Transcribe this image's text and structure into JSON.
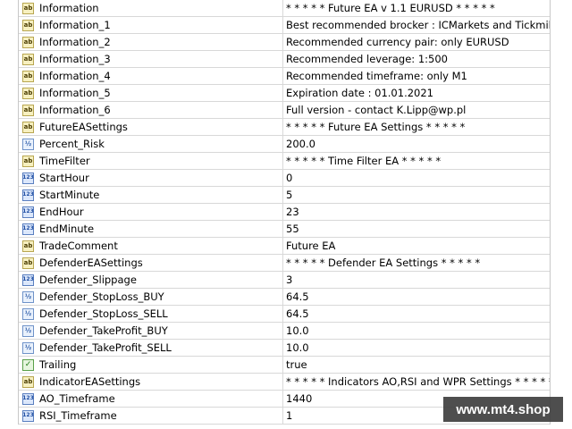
{
  "params": [
    {
      "name": "Information",
      "value": "* * * * * Future EA v 1.1 EURUSD * * * * *",
      "type": "str"
    },
    {
      "name": "Information_1",
      "value": "Best recommended brocker : ICMarkets and Tickmil...",
      "type": "str"
    },
    {
      "name": "Information_2",
      "value": "Recommended currency pair: only EURUSD",
      "type": "str"
    },
    {
      "name": "Information_3",
      "value": "Recommended leverage: 1:500",
      "type": "str"
    },
    {
      "name": "Information_4",
      "value": "Recommended timeframe: only M1",
      "type": "str"
    },
    {
      "name": "Information_5",
      "value": "Expiration date : 01.01.2021",
      "type": "str"
    },
    {
      "name": "Information_6",
      "value": "Full version - contact K.Lipp@wp.pl",
      "type": "str"
    },
    {
      "name": "FutureEASettings",
      "value": "* * * * * Future EA Settings * * * * *",
      "type": "str"
    },
    {
      "name": "Percent_Risk",
      "value": "200.0",
      "type": "dbl"
    },
    {
      "name": "TimeFilter",
      "value": "* * * * * Time Filter EA * * * * *",
      "type": "str"
    },
    {
      "name": "StartHour",
      "value": "0",
      "type": "int"
    },
    {
      "name": "StartMinute",
      "value": "5",
      "type": "int"
    },
    {
      "name": "EndHour",
      "value": "23",
      "type": "int"
    },
    {
      "name": "EndMinute",
      "value": "55",
      "type": "int"
    },
    {
      "name": "TradeComment",
      "value": "Future EA",
      "type": "str"
    },
    {
      "name": "DefenderEASettings",
      "value": "* * * * * Defender EA Settings * * * * *",
      "type": "str"
    },
    {
      "name": "Defender_Slippage",
      "value": "3",
      "type": "int"
    },
    {
      "name": "Defender_StopLoss_BUY",
      "value": "64.5",
      "type": "dbl"
    },
    {
      "name": "Defender_StopLoss_SELL",
      "value": "64.5",
      "type": "dbl"
    },
    {
      "name": "Defender_TakeProfit_BUY",
      "value": "10.0",
      "type": "dbl"
    },
    {
      "name": "Defender_TakeProfit_SELL",
      "value": "10.0",
      "type": "dbl"
    },
    {
      "name": "Trailing",
      "value": "true",
      "type": "bool"
    },
    {
      "name": "IndicatorEASettings",
      "value": "* * * * * Indicators AO,RSI and WPR Settings * * * * *",
      "type": "str"
    },
    {
      "name": "AO_Timeframe",
      "value": "1440",
      "type": "int"
    },
    {
      "name": "RSI_Timeframe",
      "value": "1",
      "type": "int"
    }
  ],
  "icon_labels": {
    "str": "ab",
    "int": "123",
    "dbl": "½",
    "bool": "✓"
  },
  "watermark": "www.mt4.shop"
}
